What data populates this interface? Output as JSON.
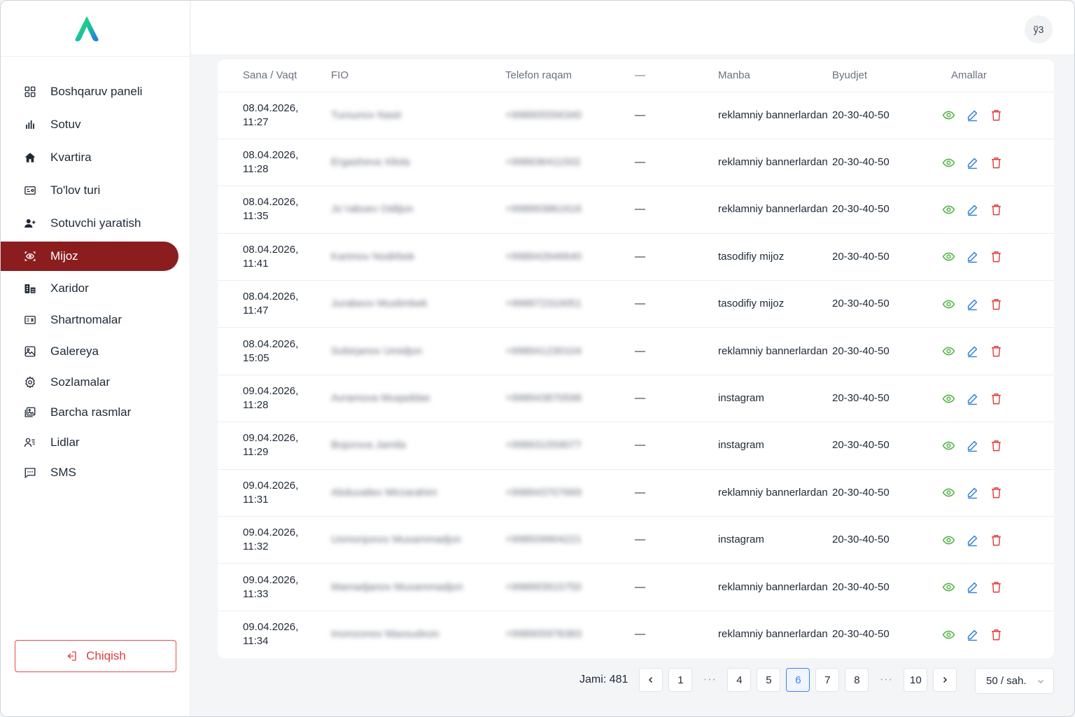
{
  "sidebar": {
    "items": [
      {
        "label": "Boshqaruv paneli",
        "icon": "dashboard-grid-icon"
      },
      {
        "label": "Sotuv",
        "icon": "bar-chart-icon"
      },
      {
        "label": "Kvartira",
        "icon": "home-icon"
      },
      {
        "label": "To'lov turi",
        "icon": "payment-card-icon"
      },
      {
        "label": "Sotuvchi yaratish",
        "icon": "user-add-icon"
      },
      {
        "label": "Mijoz",
        "icon": "scan-eye-icon",
        "active": true
      },
      {
        "label": "Xaridor",
        "icon": "buildings-icon"
      },
      {
        "label": "Shartnomalar",
        "icon": "contract-icon"
      },
      {
        "label": "Galereya",
        "icon": "gallery-icon"
      },
      {
        "label": "Sozlamalar",
        "icon": "settings-gear-icon"
      },
      {
        "label": "Barcha rasmlar",
        "icon": "images-icon"
      },
      {
        "label": "Lidlar",
        "icon": "users-list-icon"
      },
      {
        "label": "SMS",
        "icon": "message-icon"
      }
    ],
    "logout_label": "Chiqish"
  },
  "header": {
    "lang_button": "ў3"
  },
  "colors": {
    "active": "#8b1d1f",
    "view": "#4caf3f",
    "edit": "#2f7fd8",
    "delete": "#e23b3b",
    "page_active": "#3b82f6"
  },
  "table": {
    "columns": [
      "Sana / Vaqt",
      "FIO",
      "Telefon raqam",
      "—",
      "Manba",
      "Byudjet",
      "Amallar"
    ],
    "rows": [
      {
        "date": "08.04.2026,",
        "time": "11:27",
        "fio": "Tursunov Nasir",
        "phone": "+998905556340",
        "dash": "—",
        "source": "reklamniy bannerlardan",
        "budget": "20-30-40-50"
      },
      {
        "date": "08.04.2026,",
        "time": "11:28",
        "fio": "Ergasheva Xilola",
        "phone": "+998936411502",
        "dash": "—",
        "source": "reklamniy bannerlardan",
        "budget": "20-30-40-50"
      },
      {
        "date": "08.04.2026,",
        "time": "11:35",
        "fio": "Jo`raboev Odiljon",
        "phone": "+998993861616",
        "dash": "—",
        "source": "reklamniy bannerlardan",
        "budget": "20-30-40-50"
      },
      {
        "date": "08.04.2026,",
        "time": "11:41",
        "fio": "Karimov Nodirbek",
        "phone": "+998942646640",
        "dash": "—",
        "source": "tasodifiy mijoz",
        "budget": "20-30-40-50"
      },
      {
        "date": "08.04.2026,",
        "time": "11:47",
        "fio": "Jurabeov Muslimbek",
        "phone": "+998972310051",
        "dash": "—",
        "source": "tasodifiy mijoz",
        "budget": "20-30-40-50"
      },
      {
        "date": "08.04.2026,",
        "time": "15:05",
        "fio": "Sobirjanov Umidjon",
        "phone": "+998941230104",
        "dash": "—",
        "source": "reklamniy bannerlardan",
        "budget": "20-30-40-50"
      },
      {
        "date": "09.04.2026,",
        "time": "11:28",
        "fio": "Avramova Muqaddas",
        "phone": "+998943870598",
        "dash": "—",
        "source": "instagram",
        "budget": "20-30-40-50"
      },
      {
        "date": "09.04.2026,",
        "time": "11:29",
        "fio": "Bojorova Jamila",
        "phone": "+998931559077",
        "dash": "—",
        "source": "instagram",
        "budget": "20-30-40-50"
      },
      {
        "date": "09.04.2026,",
        "time": "11:31",
        "fio": "Abduvaliev Mirzarahim",
        "phone": "+998943707669",
        "dash": "—",
        "source": "reklamniy bannerlardan",
        "budget": "20-30-40-50"
      },
      {
        "date": "09.04.2026,",
        "time": "11:32",
        "fio": "Usmonjonov Muxammadjon",
        "phone": "+998509904221",
        "dash": "—",
        "source": "instagram",
        "budget": "20-30-40-50"
      },
      {
        "date": "09.04.2026,",
        "time": "11:33",
        "fio": "Mamadjanov Muxammadjon",
        "phone": "+998993915750",
        "dash": "—",
        "source": "reklamniy bannerlardan",
        "budget": "20-30-40-50"
      },
      {
        "date": "09.04.2026,",
        "time": "11:34",
        "fio": "Inomzonov Maxsudxon",
        "phone": "+998905978383",
        "dash": "—",
        "source": "reklamniy bannerlardan",
        "budget": "20-30-40-50"
      }
    ]
  },
  "pagination": {
    "total_label": "Jami: 481",
    "pages": [
      "1",
      "…",
      "4",
      "5",
      "6",
      "7",
      "8",
      "…",
      "10"
    ],
    "current": "6",
    "page_size": "50 / sah."
  }
}
